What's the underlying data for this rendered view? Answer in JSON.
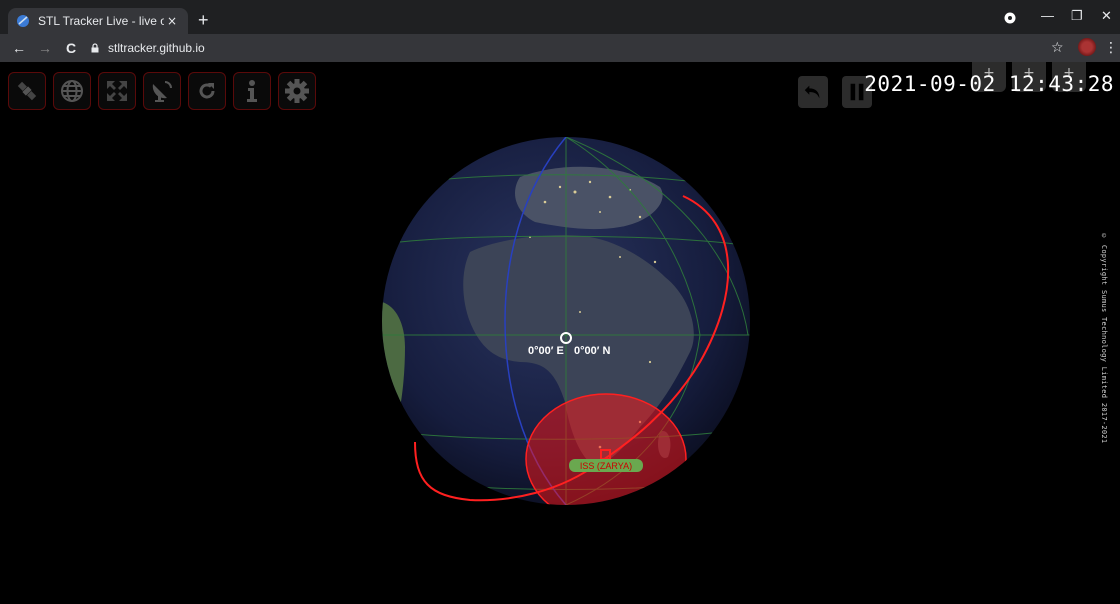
{
  "browser": {
    "tab_title": "STL Tracker Live - live online sate",
    "tab_close": "×",
    "new_tab": "+",
    "url": "stltracker.github.io",
    "back": "←",
    "forward": "→",
    "reload": "C",
    "star": "☆",
    "menu": "⋮",
    "win_min": "—",
    "win_restore": "❐",
    "win_close": "✕"
  },
  "toolbar": {
    "buttons": [
      "satellite-icon",
      "globe-icon",
      "fullscreen-icon",
      "ground-station-icon",
      "refresh-icon",
      "info-icon",
      "settings-icon"
    ]
  },
  "time": {
    "datetime": "2021-09-02 12:43:28",
    "stepper_plus": "+"
  },
  "globe": {
    "coord_lon": "0°00′ E",
    "coord_lat": "0°00′ N",
    "satellite_label": "ISS (ZARYA)"
  },
  "footer": {
    "copyright": "© Copyright Sumus Technology Limited 2017-2021"
  },
  "colors": {
    "accent_red": "#ff2020",
    "grid_green": "#2f7a3c",
    "meridian_blue": "#2840c0",
    "label_green": "#6aa84f"
  }
}
